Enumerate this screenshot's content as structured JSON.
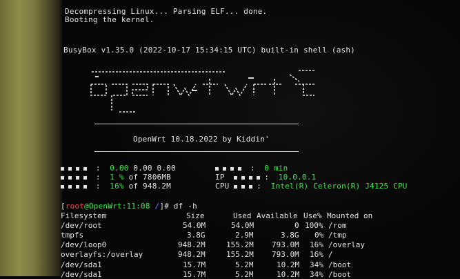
{
  "boot": {
    "line1": "Decompressing Linux... Parsing ELF... done.",
    "line2": "Booting the kernel."
  },
  "busybox": "BusyBox v1.35.0 (2022-10-17 15:34:15 UTC) built-in shell (ash)",
  "banner": "OpenWrt 10.18.2022 by Kiddin'",
  "stats": {
    "left": [
      {
        "a": "0.00",
        "b": "0.00 0.00"
      },
      {
        "a": "1 %",
        "b": "of 7806MB"
      },
      {
        "a": "16%",
        "b": "of 948.2M"
      }
    ],
    "right": [
      {
        "label": "",
        "value": "0 min"
      },
      {
        "label": "IP",
        "value": "10.0.0.1"
      },
      {
        "label": "CPU",
        "value": "Intel(R) Celeron(R) J4125 CPU"
      }
    ]
  },
  "prompt": {
    "user": "root",
    "at": "@",
    "host": "OpenWrt",
    "time": ":11:08",
    "dir": "/",
    "hash": "]# ",
    "open": "[",
    "command": "df -h"
  },
  "df": {
    "headers": [
      "Filesystem",
      "Size",
      "Used",
      "Available",
      "Use%",
      "Mounted on"
    ],
    "rows": [
      [
        "/dev/root",
        "54.0M",
        "54.0M",
        "0",
        "100%",
        "/rom"
      ],
      [
        "tmpfs",
        "3.8G",
        "2.9M",
        "3.8G",
        "0%",
        "/tmp"
      ],
      [
        "/dev/loop0",
        "948.2M",
        "155.2M",
        "793.0M",
        "16%",
        "/overlay"
      ],
      [
        "overlayfs:/overlay",
        "948.2M",
        "155.2M",
        "793.0M",
        "16%",
        "/"
      ],
      [
        "/dev/sda1",
        "15.7M",
        "5.2M",
        "10.2M",
        "34%",
        "/boot"
      ],
      [
        "/dev/sda1",
        "15.7M",
        "5.2M",
        "10.2M",
        "34%",
        "/boot"
      ]
    ]
  },
  "colors": {
    "green": "#3de84a",
    "red": "#ff4444",
    "blue": "#6b7cff",
    "text": "#e4e4e4"
  }
}
